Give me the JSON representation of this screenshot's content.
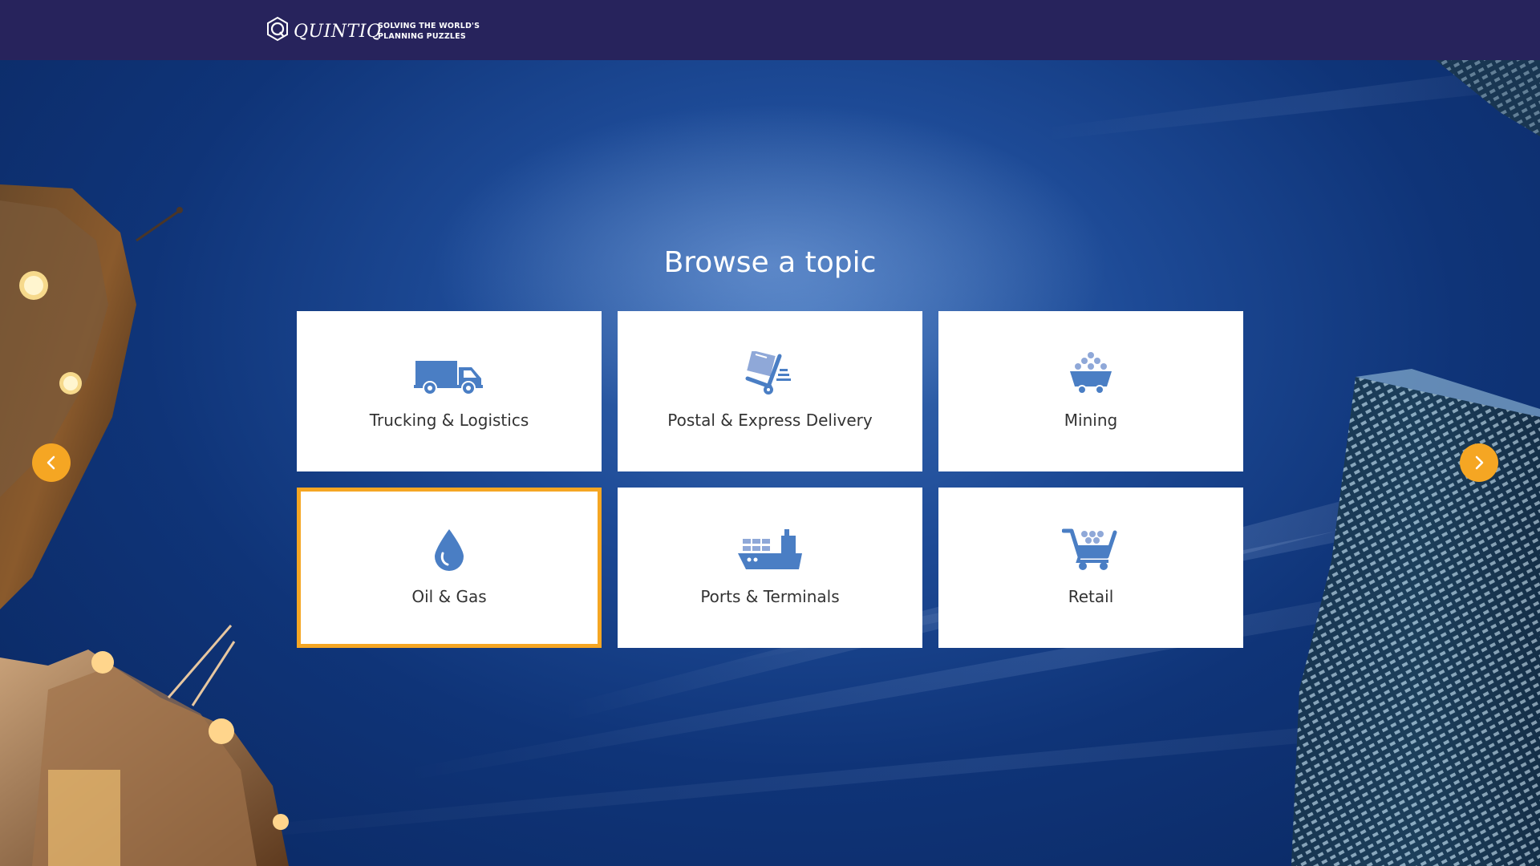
{
  "header": {
    "logo_text": "QUINTIQ",
    "tagline_line1": "SOLVING THE WORLD'S",
    "tagline_line2": "PLANNING PUZZLES"
  },
  "main": {
    "heading": "Browse a topic",
    "tiles": [
      {
        "label": "Trucking & Logistics",
        "icon": "truck-icon"
      },
      {
        "label": "Postal & Express Delivery",
        "icon": "hand-truck-icon"
      },
      {
        "label": "Mining",
        "icon": "mine-cart-icon"
      },
      {
        "label": "Oil & Gas",
        "icon": "oil-drop-icon",
        "selected": true
      },
      {
        "label": "Ports & Terminals",
        "icon": "cargo-ship-icon"
      },
      {
        "label": "Retail",
        "icon": "shopping-cart-icon"
      }
    ]
  },
  "navigation": {
    "prev": "chevron-left-icon",
    "next": "chevron-right-icon"
  },
  "colors": {
    "header_bg": "#27235c",
    "icon_blue": "#4a7ec4",
    "accent_orange": "#f5a623",
    "tile_bg": "#ffffff"
  }
}
